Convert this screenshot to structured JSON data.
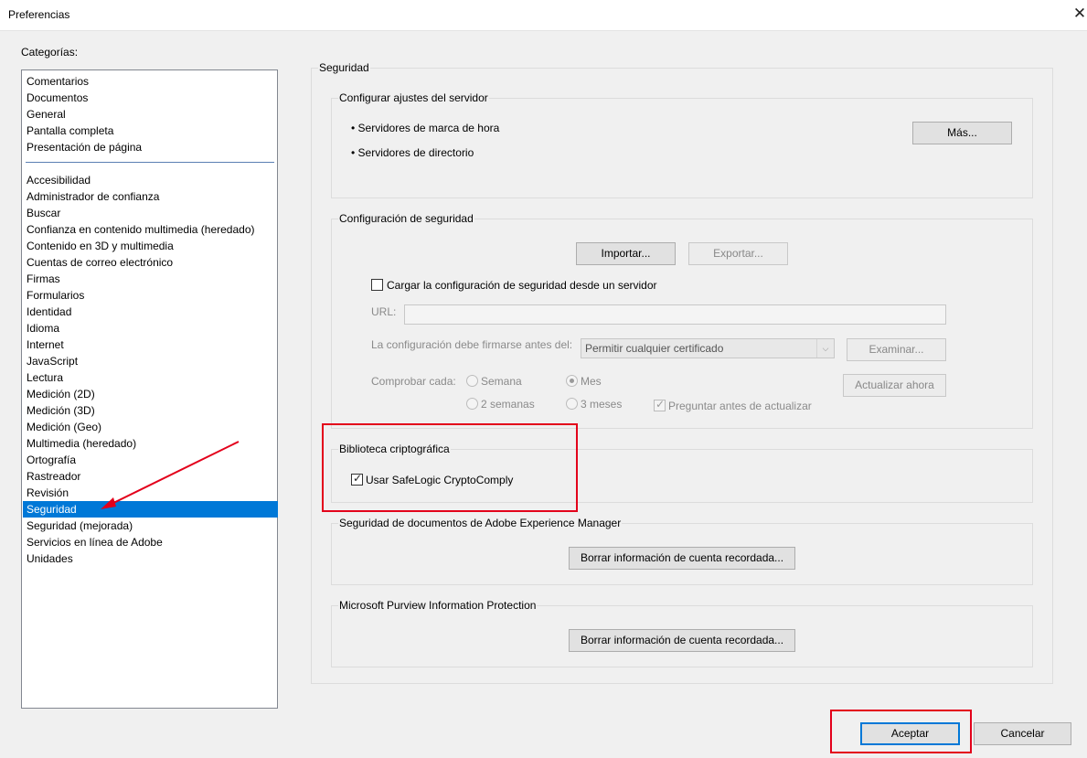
{
  "window": {
    "title": "Preferencias",
    "close_icon": "close-icon",
    "close_glyph": "✕"
  },
  "categories": {
    "label": "Categorías:",
    "group1": [
      "Comentarios",
      "Documentos",
      "General",
      "Pantalla completa",
      "Presentación de página"
    ],
    "group2": [
      "Accesibilidad",
      "Administrador de confianza",
      "Buscar",
      "Confianza en contenido multimedia (heredado)",
      "Contenido en 3D y multimedia",
      "Cuentas de correo electrónico",
      "Firmas",
      "Formularios",
      "Identidad",
      "Idioma",
      "Internet",
      "JavaScript",
      "Lectura",
      "Medición (2D)",
      "Medición (3D)",
      "Medición (Geo)",
      "Multimedia (heredado)",
      "Ortografía",
      "Rastreador",
      "Revisión",
      "Seguridad",
      "Seguridad (mejorada)",
      "Servicios en línea de Adobe",
      "Unidades"
    ],
    "selected": "Seguridad",
    "selected_color": "#0078d7"
  },
  "panel": {
    "title": "Seguridad",
    "server": {
      "title": "Configurar ajustes del servidor",
      "items": [
        "Servidores de marca de hora",
        "Servidores de directorio"
      ],
      "more_button": "Más..."
    },
    "security": {
      "title": "Configuración de seguridad",
      "import_button": "Importar...",
      "export_button": "Exportar...",
      "load_checkbox": {
        "label": "Cargar la configuración de seguridad desde un servidor",
        "checked": false
      },
      "url_label": "URL:",
      "url_value": "",
      "sign_label": "La configuración debe firmarse antes del:",
      "sign_select": "Permitir cualquier certificado",
      "examine_button": "Examinar...",
      "check_label": "Comprobar cada:",
      "options": [
        "Semana",
        "Mes",
        "2 semanas",
        "3 meses"
      ],
      "selected_option": "Mes",
      "ask_checkbox": {
        "label": "Preguntar antes de actualizar",
        "checked": true
      },
      "update_button": "Actualizar ahora"
    },
    "crypto": {
      "title": "Biblioteca criptográfica",
      "checkbox": {
        "label": "Usar SafeLogic CryptoComply",
        "checked": true
      }
    },
    "aem": {
      "title": "Seguridad de documentos de Adobe Experience Manager",
      "button": "Borrar información de cuenta recordada..."
    },
    "purview": {
      "title": "Microsoft Purview Information Protection",
      "button": "Borrar información de cuenta recordada..."
    }
  },
  "footer": {
    "ok_button": "Aceptar",
    "cancel_button": "Cancelar"
  },
  "annotations": {
    "highlight_color": "#e3001b"
  },
  "glyphs": {
    "check": "✓",
    "arrow": "⌵"
  }
}
